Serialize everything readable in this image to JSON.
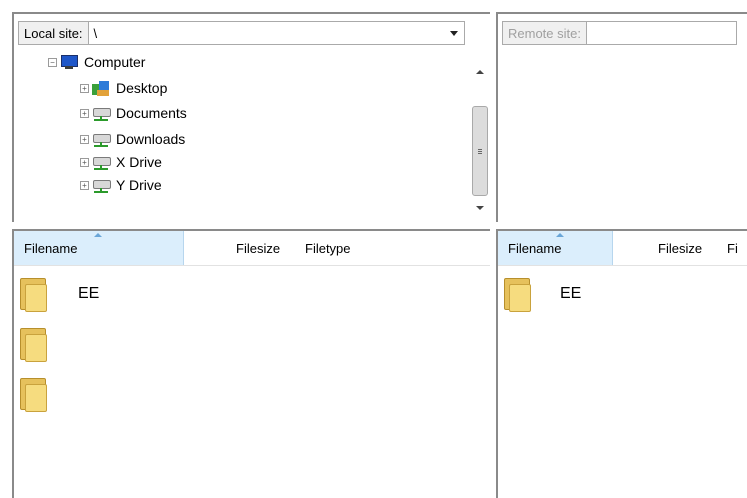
{
  "local": {
    "site_label": "Local site:",
    "path": "\\",
    "tree": [
      {
        "label": "Computer",
        "icon": "computer-icon",
        "expander": "−",
        "level": 0
      },
      {
        "label": "Desktop",
        "icon": "desktop-icon",
        "expander": "+",
        "level": 1
      },
      {
        "label": "Documents",
        "icon": "network-drive-icon",
        "expander": "+",
        "level": 1
      },
      {
        "label": "Downloads",
        "icon": "network-drive-icon",
        "expander": "+",
        "level": 1
      },
      {
        "label": "X Drive",
        "icon": "network-drive-icon",
        "expander": "+",
        "level": 1
      },
      {
        "label": "Y Drive",
        "icon": "network-drive-icon",
        "expander": "+",
        "level": 1
      }
    ],
    "columns": [
      "Filename",
      "Filesize",
      "Filetype"
    ],
    "files": [
      {
        "name": "EE",
        "icon": "folder-icon"
      },
      {
        "name": "",
        "icon": "folder-icon"
      },
      {
        "name": "",
        "icon": "folder-icon"
      }
    ]
  },
  "remote": {
    "site_label": "Remote site:",
    "path": "",
    "columns": [
      "Filename",
      "Filesize",
      "Fi"
    ],
    "files": [
      {
        "name": "EE",
        "icon": "folder-icon"
      }
    ]
  },
  "colors": {
    "sorted_header": "#dbeefc",
    "folder": "#f6dc7f",
    "pane_border": "#8a8a8a"
  }
}
